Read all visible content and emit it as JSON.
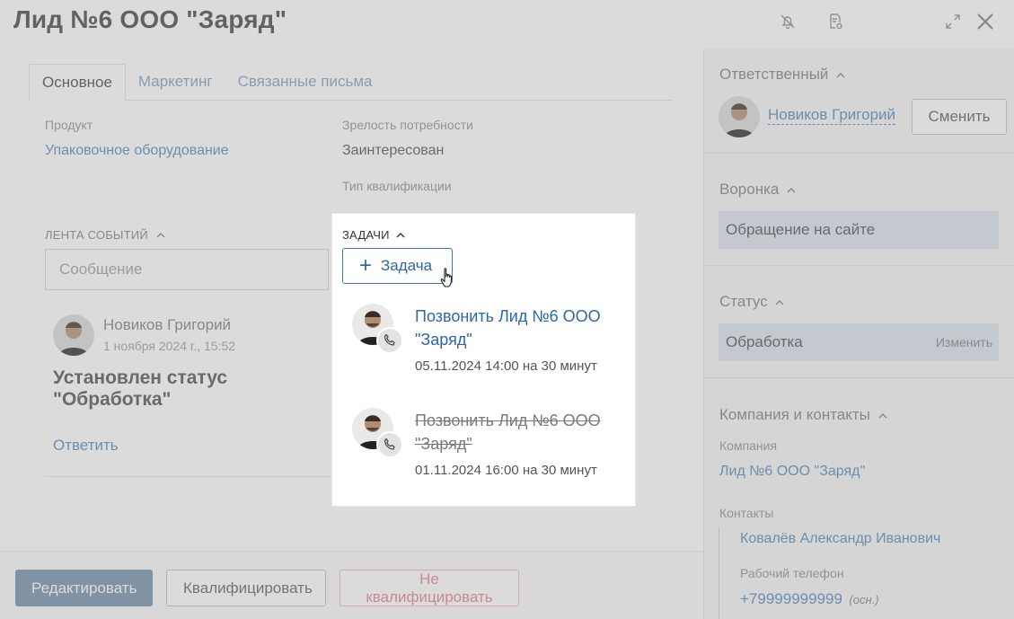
{
  "header": {
    "title": "Лид №6 ООО \"Заряд\"",
    "icons": [
      "bell-off-icon",
      "document-settings-icon",
      "expand-icon",
      "close-icon"
    ]
  },
  "tabs": [
    {
      "label": "Основное",
      "active": true
    },
    {
      "label": "Маркетинг",
      "active": false
    },
    {
      "label": "Связанные письма",
      "active": false
    }
  ],
  "fields": {
    "product_label": "Продукт",
    "product_value": "Упаковочное оборудование",
    "maturity_label": "Зрелость потребности",
    "maturity_value": "Заинтересован",
    "qualification_label": "Тип квалификации"
  },
  "feed": {
    "title": "ЛЕНТА СОБЫТИЙ",
    "message_placeholder": "Сообщение",
    "event": {
      "author": "Новиков Григорий",
      "date": "1 ноября 2024 г., 15:52",
      "text": "Установлен статус \"Обработка\"",
      "reply": "Ответить"
    }
  },
  "tasks": {
    "title": "ЗАДАЧИ",
    "add_label": "Задача",
    "items": [
      {
        "title": "Позвонить Лид №6 ООО \"Заряд\"",
        "date": "05.11.2024 14:00",
        "duration": "на 30 минут",
        "done": false
      },
      {
        "title": "Позвонить Лид №6 ООО \"Заряд\"",
        "date": "01.11.2024 16:00",
        "duration": "на 30 минут",
        "done": true
      }
    ]
  },
  "sidebar": {
    "responsible_title": "Ответственный",
    "responsible_name": "Новиков Григорий",
    "change_label": "Сменить",
    "funnel_title": "Воронка",
    "funnel_value": "Обращение на сайте",
    "status_title": "Статус",
    "status_value": "Обработка",
    "status_change": "Изменить",
    "company_title": "Компания и контакты",
    "company_label": "Компания",
    "company_value": "Лид №6 ООО \"Заряд\"",
    "contacts_label": "Контакты",
    "contact_name": "Ковалёв Александр Иванович",
    "phone_label": "Рабочий телефон",
    "phone_value": "+79999999999",
    "phone_note": "(осн.)"
  },
  "footer": {
    "edit_label": "Редактировать",
    "qualify_label": "Квалифицировать",
    "disqualify_label": "Не квалифицировать"
  },
  "colors": {
    "accent": "#2f67a6",
    "link": "#4e83b6",
    "danger": "#e47b84",
    "primary_button": "#6e8aa8"
  }
}
